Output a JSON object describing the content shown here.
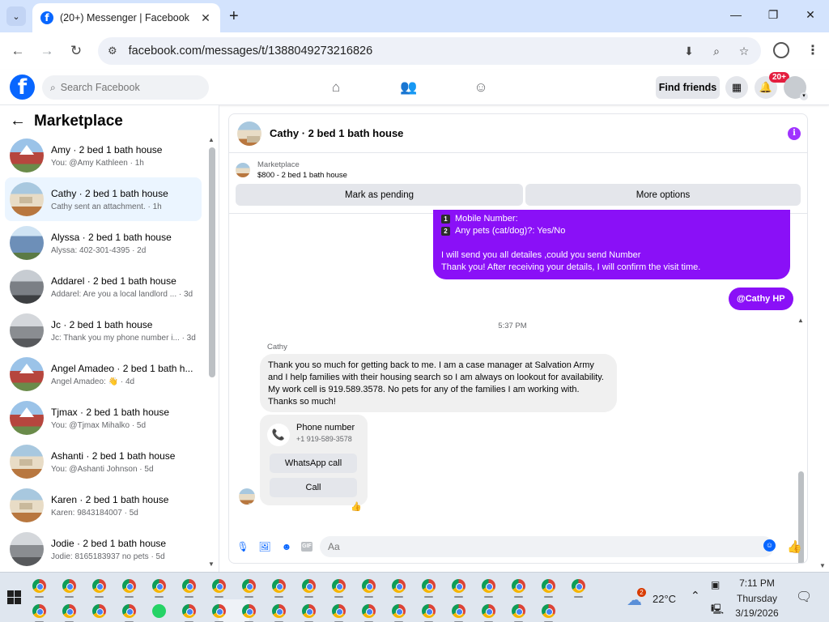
{
  "browser": {
    "tab_title": "(20+) Messenger | Facebook",
    "url": "facebook.com/messages/t/1388049273216826"
  },
  "facebook": {
    "search_placeholder": "Search Facebook",
    "find_friends_label": "Find friends",
    "notification_badge": "20+"
  },
  "sidebar": {
    "title": "Marketplace",
    "conversations": [
      {
        "name": "Amy · 2 bed 1 bath house",
        "preview": "You: @Amy Kathleen · 1h",
        "avatar": "house-red"
      },
      {
        "name": "Cathy · 2 bed 1 bath house",
        "preview": "Cathy sent an attachment. · 1h",
        "avatar": "house-beige",
        "active": true
      },
      {
        "name": "Alyssa · 2 bed 1 bath house",
        "preview": "Alyssa: 402-301-4395 · 2d",
        "avatar": "house-blue"
      },
      {
        "name": "Addarel · 2 bed 1 bath house",
        "preview": "Addarel: Are you a local landlord ...  · 3d",
        "avatar": "house-grey"
      },
      {
        "name": "Jc · 2 bed 1 bath house",
        "preview": "Jc: Thank you my phone number i... · 3d",
        "avatar": "house-grey2"
      },
      {
        "name": "Angel Amadeo · 2 bed 1 bath h...",
        "preview": "Angel Amadeo: 👋 · 4d",
        "avatar": "house-red"
      },
      {
        "name": "Tjmax · 2 bed 1 bath house",
        "preview": "You: @Tjmax Mihalko · 5d",
        "avatar": "house-red"
      },
      {
        "name": "Ashanti · 2 bed 1 bath house",
        "preview": "You: @Ashanti Johnson · 5d",
        "avatar": "house-beige"
      },
      {
        "name": "Karen · 2 bed 1 bath house",
        "preview": "Karen: 9843184007 · 5d",
        "avatar": "house-beige"
      },
      {
        "name": "Jodie · 2 bed 1 bath house",
        "preview": "Jodie: 8165183937 no pets · 5d",
        "avatar": "house-grey2"
      }
    ]
  },
  "chat": {
    "title": "Cathy · 2 bed 1 bath house",
    "marketplace_label": "Marketplace",
    "listing": "$800 - 2 bed 1 bath house",
    "mark_pending_label": "Mark as pending",
    "more_options_label": "More options",
    "outgoing_lines": {
      "line1_key": "1",
      "line1": "Mobile Number:",
      "line2_key": "2",
      "line2": "Any pets (cat/dog)?: Yes/No",
      "line3": "I will send you all detailes ,could you send Number",
      "line4": "Thank you! After receiving your details, I will confirm the visit time."
    },
    "mention_label": "@Cathy HP",
    "timestamp": "5:37 PM",
    "sender_name": "Cathy",
    "incoming_text": "Thank you so much for getting back to me. I am a case manager at Salvation Army and I help families with their housing search so I am always on lookout for availability. My work cell is 919.589.3578. No pets for any of the families I am working with. Thanks so much!",
    "phone_card": {
      "title": "Phone number",
      "number": "+1 919-589-3578",
      "whatsapp_label": "WhatsApp call",
      "call_label": "Call"
    },
    "reaction": "👍",
    "composer_placeholder": "Aa"
  },
  "taskbar": {
    "temperature": "22°C",
    "weather_badge": "2",
    "time": "7:11 PM",
    "day": "Thursday",
    "date": "3/19/2026"
  }
}
